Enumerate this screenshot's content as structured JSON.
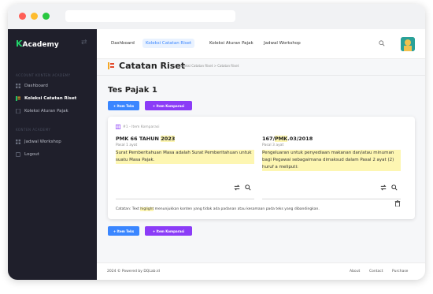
{
  "sidebar": {
    "brand": "Academy",
    "brand_k": "K",
    "section_account": "ACCOUNT KONTEN ACADEMY",
    "items_top": [
      {
        "label": "Dashboard"
      },
      {
        "label": "Koleksi Catatan Riset"
      },
      {
        "label": "Koleksi Aturan Pajak"
      }
    ],
    "section_konten": "KONTEN ACADEMY",
    "items_bottom": [
      {
        "label": "Jadwal Workshop"
      },
      {
        "label": "Logout"
      }
    ]
  },
  "topnav": {
    "links": [
      "Dashboard",
      "Koleksi Catatan Riset",
      "Koleksi Aturan Pajak",
      "Jadwal Workshop"
    ]
  },
  "page": {
    "title": "Catatan Riset",
    "breadcrumb": "Koleksi Catatan Riset  >  Catatan Riset",
    "doc_title": "Tes Pajak 1",
    "btn_teks": "+ Item Teks",
    "btn_komparasi": "+ Item Komparasi"
  },
  "card": {
    "header": "#1 - Item Komparasi",
    "left": {
      "title_pre": "PMK 66 TAHUN ",
      "title_hl": "2023",
      "sub": "Pasal 1 ayat",
      "text": "Surat Pemberitahuan Masa adalah Surat Pemberitahuan untuk suatu Masa Pajak."
    },
    "right": {
      "title_pre": "167/",
      "title_hl": "PMK",
      "title_post": ".03/2018",
      "sub": "Pasal 3 ayat",
      "text": "Pengeluaran untuk penyediaan makanan dan/atau minuman bagi Pegawai sebagaimana dimaksud dalam Pasal 2 ayat (2) huruf a meliputi:"
    },
    "note_pre": "Catatan: Text ",
    "note_hl": "higlight",
    "note_post": " menunjukkan konten yang tidak ada padanan atau kesamaan pada teks yang dibandingkan."
  },
  "footer": {
    "copyright": "2024 © Powered by DQLab.id",
    "links": [
      "About",
      "Contact",
      "Purchase"
    ]
  },
  "colors": {
    "accent_blue": "#3a86ff",
    "accent_purple": "#8b3cf7",
    "sidebar_bg": "#1f1f2b",
    "highlight": "#fdf6b2"
  }
}
